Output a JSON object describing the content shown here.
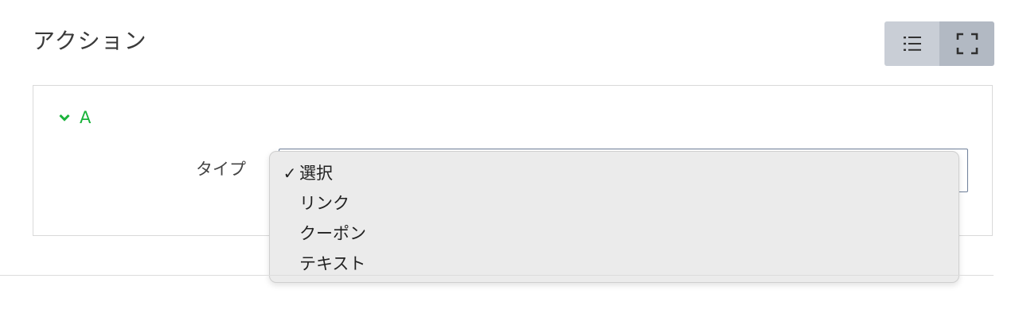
{
  "section": {
    "title": "アクション"
  },
  "view_toggle": {
    "list_icon": "list-icon",
    "fullscreen_icon": "fullscreen-icon"
  },
  "action_group": {
    "name": "A",
    "accent_color": "#19b33a",
    "type_field": {
      "label": "タイプ",
      "selected": "選択",
      "options": [
        {
          "label": "選択",
          "checked": true
        },
        {
          "label": "リンク",
          "checked": false
        },
        {
          "label": "クーポン",
          "checked": false
        },
        {
          "label": "テキスト",
          "checked": false
        }
      ],
      "check_mark": "✓"
    }
  }
}
